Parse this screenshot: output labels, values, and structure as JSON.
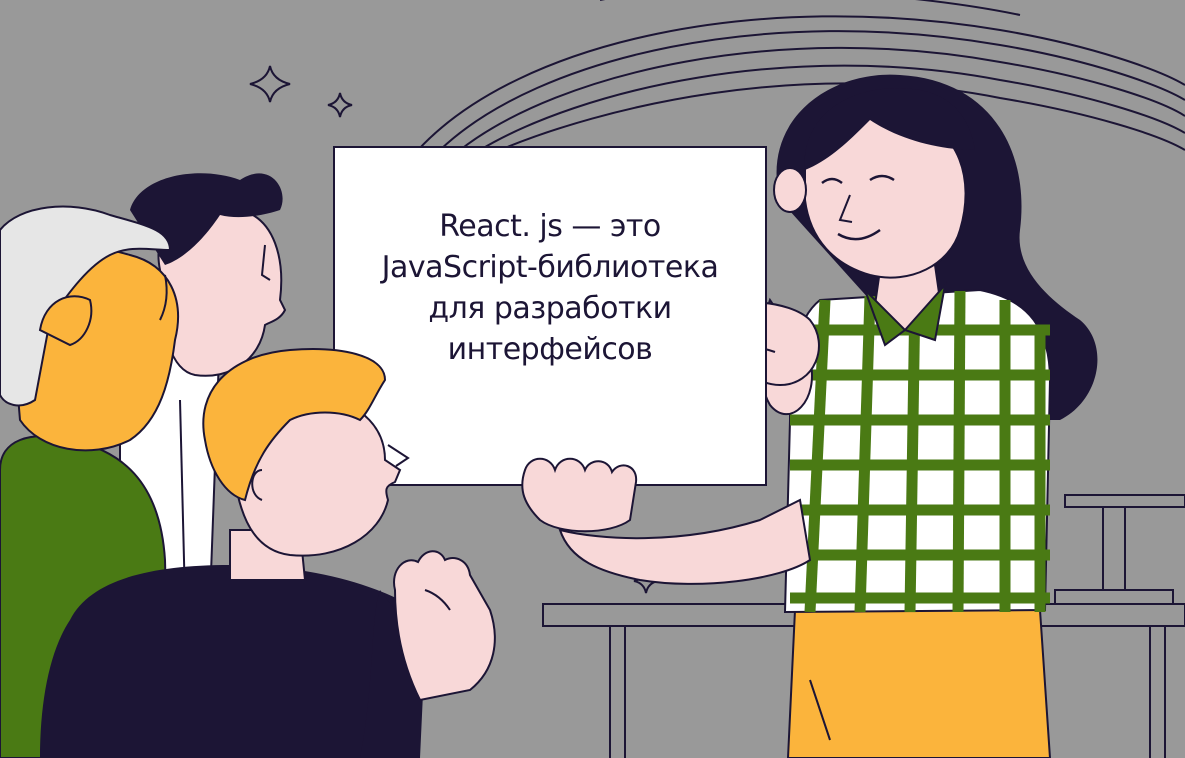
{
  "illustration": {
    "colors": {
      "background": "#999999",
      "outline": "#1c1535",
      "skin": "#f8d8d8",
      "yellow": "#fbb43c",
      "green": "#4a7a14",
      "white": "#ffffff",
      "hair_grey": "#e6e6e6"
    },
    "sign": {
      "lines": [
        "React. js — это",
        "JavaScript-библиотека",
        "для разработки",
        "интерфейсов"
      ]
    },
    "icons": [
      "sparkle-icon",
      "sparkle-icon",
      "sparkle-icon"
    ]
  }
}
